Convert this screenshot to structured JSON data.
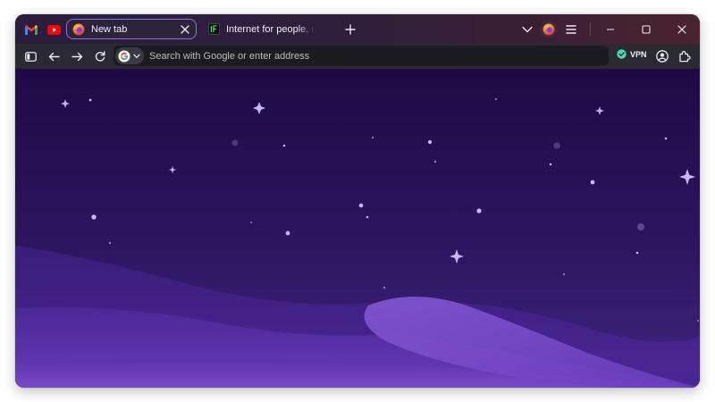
{
  "tabs": {
    "pinned": [
      {
        "name": "gmail",
        "icon": "gmail-icon"
      },
      {
        "name": "youtube",
        "icon": "youtube-icon"
      }
    ],
    "active": {
      "title": "New tab",
      "icon": "firefox-icon"
    },
    "inactive": {
      "title": "Internet for people, no",
      "icon": "mozilla-icon"
    }
  },
  "toolbar": {
    "url_placeholder": "Search with Google or enter address",
    "vpn_label": "VPN"
  },
  "colors": {
    "accent": "#8f6cf0",
    "sky_top": "#1e0a45",
    "sky_bottom": "#6a3aba",
    "vpn_ok": "#3fe1b0"
  }
}
